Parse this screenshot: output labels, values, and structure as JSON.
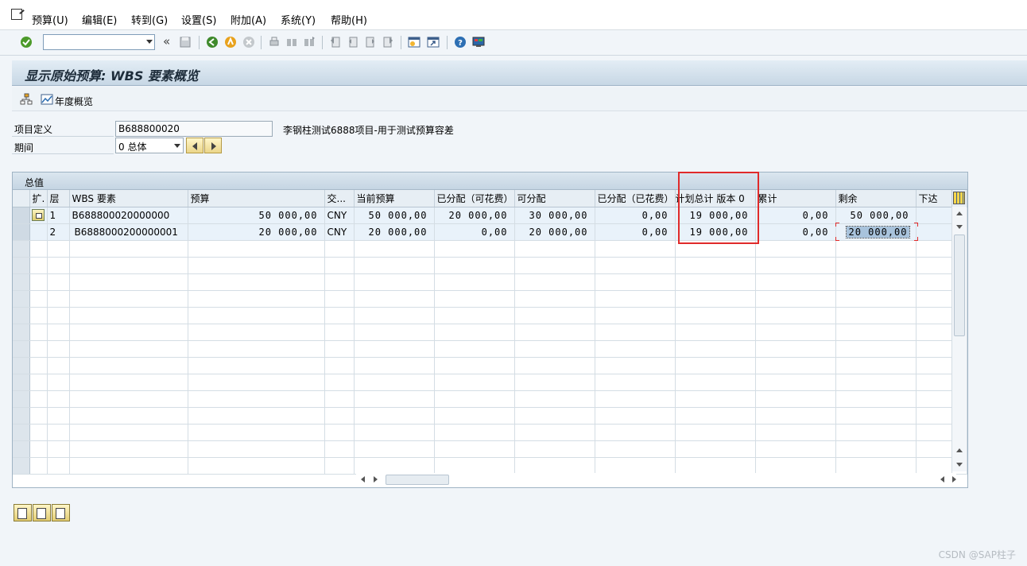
{
  "menu": {
    "items": [
      {
        "label": "预算(U)"
      },
      {
        "label": "编辑(E)"
      },
      {
        "label": "转到(G)"
      },
      {
        "label": "设置(S)"
      },
      {
        "label": "附加(A)"
      },
      {
        "label": "系统(Y)"
      },
      {
        "label": "帮助(H)"
      }
    ]
  },
  "toolbar": {
    "command_field_value": "",
    "collapse_symbol": "«"
  },
  "screen": {
    "title": "显示原始预算: WBS 要素概览",
    "annual_overview_label": "年度概览"
  },
  "header": {
    "project_label": "项目定义",
    "project_value": "B688800020",
    "project_description": "李钢柱测试6888项目-用于测试预算容差",
    "period_label": "期间",
    "period_value": "0 总体"
  },
  "grid": {
    "caption": "总值",
    "columns": [
      "扩.",
      "层",
      "WBS 要素",
      "预算",
      "交...",
      "当前预算",
      "已分配（可花费）",
      "可分配",
      "已分配（已花费）",
      "计划总计 版本 0",
      "累计",
      "剩余",
      "下达"
    ],
    "rows": [
      {
        "level": "1",
        "wbs": "B688800020000000",
        "budget": "50 000,00",
        "currency": "CNY",
        "current": "50 000,00",
        "assigned_spendable": "20 000,00",
        "distributable": "30 000,00",
        "assigned_spent": "0,00",
        "plan_total": "19 000,00",
        "cumulative": "0,00",
        "remaining": "50 000,00",
        "released": ""
      },
      {
        "level": "2",
        "wbs": "B6888000200000001",
        "budget": "20 000,00",
        "currency": "CNY",
        "current": "20 000,00",
        "assigned_spendable": "0,00",
        "distributable": "20 000,00",
        "assigned_spent": "0,00",
        "plan_total": "19 000,00",
        "cumulative": "0,00",
        "remaining": "20 000,00",
        "released": ""
      }
    ]
  },
  "watermark": "CSDN @SAP柱子",
  "colors": {
    "highlight": "#e02a2a",
    "title_gradient_top": "#e3edf5",
    "title_gradient_bottom": "#c7d7e5"
  }
}
